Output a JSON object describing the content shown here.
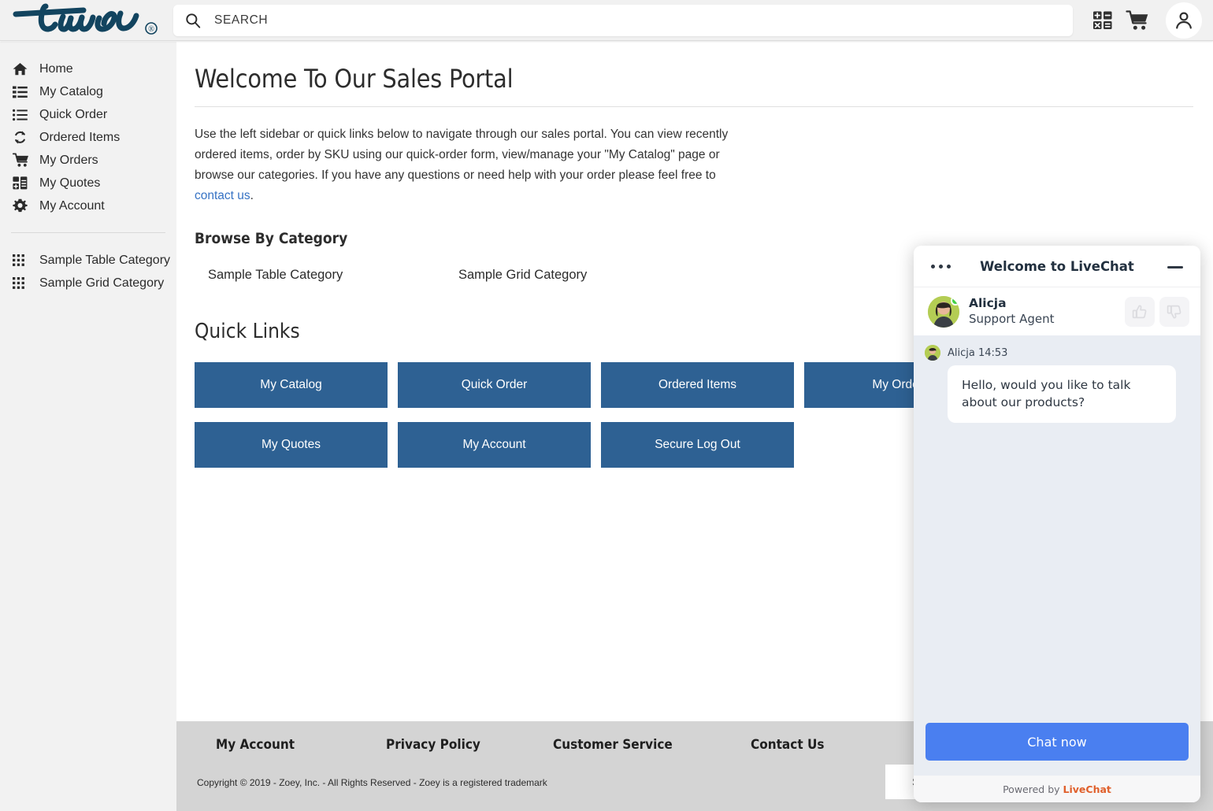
{
  "header": {
    "logo_text": "true",
    "logo_trademark": "®",
    "logo_color": "#12445f",
    "search": {
      "placeholder": "SEARCH",
      "value": "",
      "icon": "search-icon"
    },
    "icons": [
      {
        "name": "calculator-icon",
        "label": "Calculator"
      },
      {
        "name": "cart-icon",
        "label": "Cart"
      },
      {
        "name": "account-icon",
        "label": "Account"
      }
    ]
  },
  "sidebar": {
    "items": [
      {
        "label": "Home",
        "icon": "home-icon"
      },
      {
        "label": "My Catalog",
        "icon": "list-icon"
      },
      {
        "label": "Quick Order",
        "icon": "list-ul-icon"
      },
      {
        "label": "Ordered Items",
        "icon": "sync-icon"
      },
      {
        "label": "My Orders",
        "icon": "cart-icon"
      },
      {
        "label": "My Quotes",
        "icon": "quote-grid-icon"
      },
      {
        "label": "My Account",
        "icon": "gear-icon"
      }
    ],
    "categories": [
      {
        "label": "Sample Table Category",
        "icon": "grid-dots-icon"
      },
      {
        "label": "Sample Grid Category",
        "icon": "grid-dots-icon"
      }
    ]
  },
  "main": {
    "title": "Welcome To Our Sales Portal",
    "intro_before_link": "Use the left sidebar or quick links below to navigate through our sales portal. You can view recently ordered items, order by SKU using our quick-order form, view/manage your \"My Catalog\" page or browse our categories. If you have any questions or need help with your order please feel free to ",
    "intro_link": "contact us",
    "intro_after_link": ".",
    "browse_heading": "Browse By Category",
    "categories": [
      {
        "label": "Sample Table Category"
      },
      {
        "label": "Sample Grid Category"
      }
    ],
    "quicklinks_heading": "Quick Links",
    "quicklinks": [
      {
        "label": "My Catalog"
      },
      {
        "label": "Quick Order"
      },
      {
        "label": "Ordered Items"
      },
      {
        "label": "My Orders"
      },
      {
        "label": "My Quotes"
      },
      {
        "label": "My Account"
      },
      {
        "label": "Secure Log Out"
      }
    ],
    "button_color": "#2e6193"
  },
  "footer": {
    "columns": [
      {
        "label": "My Account"
      },
      {
        "label": "Privacy Policy"
      },
      {
        "label": "Customer Service"
      },
      {
        "label": "Contact Us"
      }
    ],
    "copyright": "Copyright © 2019 - Zoey, Inc. - All Rights Reserved - Zoey is a registered trademark",
    "newsletter_partial_text": "Sub"
  },
  "chat": {
    "title": "Welcome to LiveChat",
    "menu_icon": "ellipsis-icon",
    "minimize_icon": "minimize-icon",
    "agent": {
      "name": "Alicja",
      "role": "Support Agent",
      "status": "online",
      "status_color": "#43d049"
    },
    "rate_buttons": [
      {
        "name": "thumbs-up-icon"
      },
      {
        "name": "thumbs-down-icon"
      }
    ],
    "messages": [
      {
        "author": "Alicja",
        "time": "14:53",
        "meta": "Alicja 14:53",
        "text": "Hello, would you like to talk about our products?"
      }
    ],
    "cta_label": "Chat now",
    "cta_color": "#4a7ff0",
    "footer_prefix": "Powered by",
    "footer_brand_a": "Live",
    "footer_brand_b": "Chat",
    "brand_accent": "#e0602c"
  }
}
